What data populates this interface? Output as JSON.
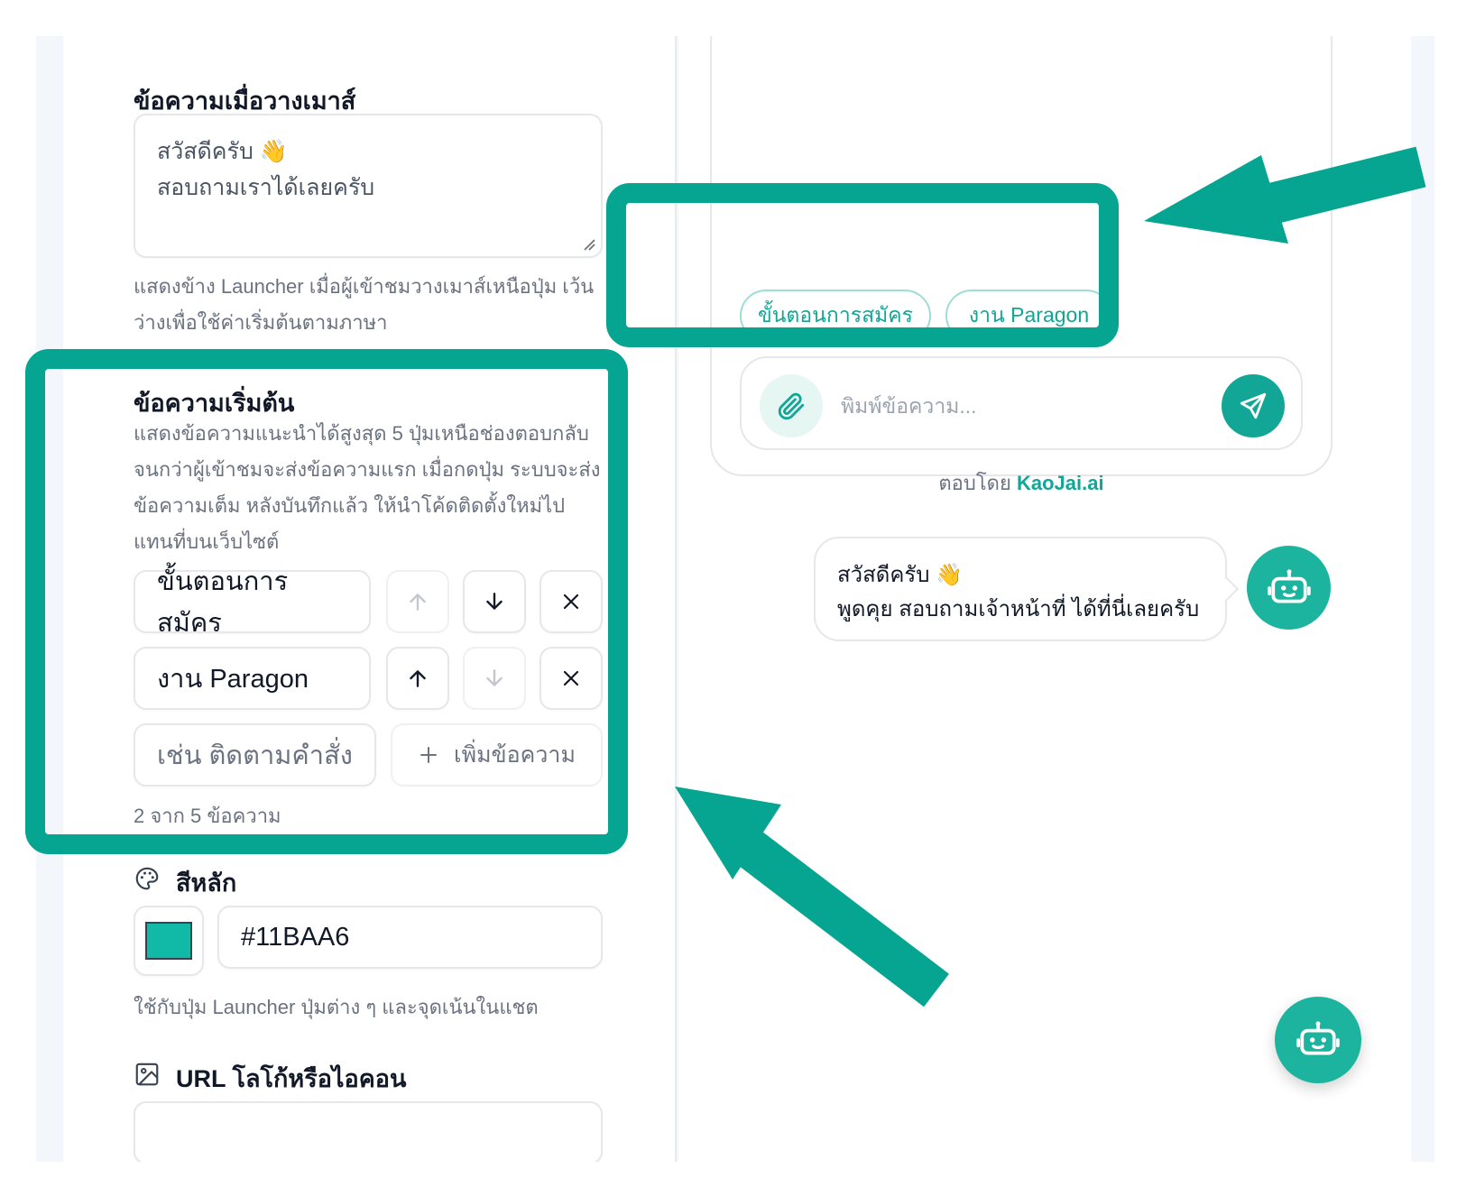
{
  "colors": {
    "accent": "#11BAA6",
    "highlight": "#05A592"
  },
  "settings": {
    "hover_message": {
      "label": "ข้อความเมื่อวางเมาส์",
      "lines": [
        "สวัสดีครับ 👋",
        "สอบถามเราได้เลยครับ"
      ],
      "help_lines": [
        "แสดงข้าง Launcher เมื่อผู้เข้าชมวางเมาส์เหนือปุ่ม เว้น",
        "ว่างเพื่อใช้ค่าเริ่มต้นตามภาษา"
      ]
    },
    "starters": {
      "label": "ข้อความเริ่มต้น",
      "help_lines": [
        "แสดงข้อความแนะนำได้สูงสุด 5 ปุ่มเหนือช่องตอบกลับ",
        "จนกว่าผู้เข้าชมจะส่งข้อความแรก เมื่อกดปุ่ม ระบบจะส่ง",
        "ข้อความเต็ม หลังบันทึกแล้ว ให้นำโค้ดติดตั้งใหม่ไป",
        "แทนที่บนเว็บไซต์"
      ],
      "items": [
        "ขั้นตอนการสมัคร",
        "งาน Paragon"
      ],
      "new_placeholder": "เช่น ติดตามคำสั่ง",
      "add_label": "เพิ่มข้อความ",
      "counter": "2 จาก 5 ข้อความ"
    },
    "primary_color": {
      "label": "สีหลัก",
      "value": "#11BAA6",
      "help": "ใช้กับปุ่ม Launcher ปุ่มต่าง ๆ และจุดเน้นในแชต"
    },
    "logo_url": {
      "label": "URL โลโก้หรือไอคอน"
    }
  },
  "preview": {
    "chips": [
      "ขั้นตอนการสมัคร",
      "งาน Paragon"
    ],
    "composer_placeholder": "พิมพ์ข้อความ...",
    "powered_prefix": "ตอบโดย",
    "powered_brand": "KaoJai.ai",
    "bubble_lines": [
      "สวัสดีครับ 👋",
      "พูดคุย สอบถามเจ้าหน้าที่ ได้ที่นี่เลยครับ"
    ]
  },
  "icons": [
    "resize-grip-icon",
    "arrow-up-icon",
    "arrow-down-icon",
    "close-icon",
    "plus-icon",
    "palette-icon",
    "image-icon",
    "paperclip-icon",
    "send-icon",
    "bot-icon",
    "annotation-arrow"
  ]
}
